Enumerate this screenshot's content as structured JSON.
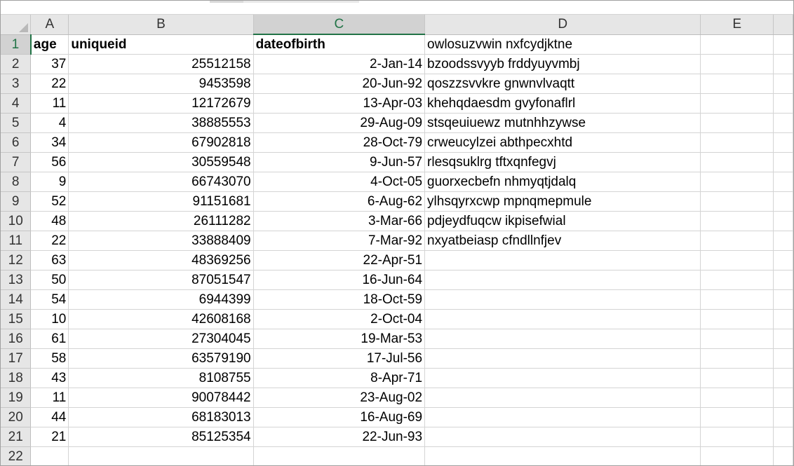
{
  "columns": [
    "A",
    "B",
    "C",
    "D",
    "E"
  ],
  "selected_column": "C",
  "selected_row": "1",
  "header_row": {
    "row": "1",
    "A": "age",
    "B": "uniqueid",
    "C": "dateofbirth",
    "D": "owlosuzvwin nxfcydjktne",
    "E": ""
  },
  "rows": [
    {
      "row": "2",
      "A": "37",
      "B": "25512158",
      "C": "2-Jan-14",
      "D": "bzoodssvyyb frddyuyvmbj",
      "E": ""
    },
    {
      "row": "3",
      "A": "22",
      "B": "9453598",
      "C": "20-Jun-92",
      "D": "qoszzsvvkre gnwnvlvaqtt",
      "E": ""
    },
    {
      "row": "4",
      "A": "11",
      "B": "12172679",
      "C": "13-Apr-03",
      "D": "khehqdaesdm gvyfonaflrl",
      "E": ""
    },
    {
      "row": "5",
      "A": "4",
      "B": "38885553",
      "C": "29-Aug-09",
      "D": "stsqeuiuewz mutnhhzywse",
      "E": ""
    },
    {
      "row": "6",
      "A": "34",
      "B": "67902818",
      "C": "28-Oct-79",
      "D": "crweucylzei abthpecxhtd",
      "E": ""
    },
    {
      "row": "7",
      "A": "56",
      "B": "30559548",
      "C": "9-Jun-57",
      "D": "rlesqsuklrg tftxqnfegvj",
      "E": ""
    },
    {
      "row": "8",
      "A": "9",
      "B": "66743070",
      "C": "4-Oct-05",
      "D": "guorxecbefn nhmyqtjdalq",
      "E": ""
    },
    {
      "row": "9",
      "A": "52",
      "B": "91151681",
      "C": "6-Aug-62",
      "D": "ylhsqyrxcwp mpnqmepmule",
      "E": ""
    },
    {
      "row": "10",
      "A": "48",
      "B": "26111282",
      "C": "3-Mar-66",
      "D": "pdjeydfuqcw ikpisefwial",
      "E": ""
    },
    {
      "row": "11",
      "A": "22",
      "B": "33888409",
      "C": "7-Mar-92",
      "D": "nxyatbeiasp cfndllnfjev",
      "E": ""
    },
    {
      "row": "12",
      "A": "63",
      "B": "48369256",
      "C": "22-Apr-51",
      "D": "",
      "E": ""
    },
    {
      "row": "13",
      "A": "50",
      "B": "87051547",
      "C": "16-Jun-64",
      "D": "",
      "E": ""
    },
    {
      "row": "14",
      "A": "54",
      "B": "6944399",
      "C": "18-Oct-59",
      "D": "",
      "E": ""
    },
    {
      "row": "15",
      "A": "10",
      "B": "42608168",
      "C": "2-Oct-04",
      "D": "",
      "E": ""
    },
    {
      "row": "16",
      "A": "61",
      "B": "27304045",
      "C": "19-Mar-53",
      "D": "",
      "E": ""
    },
    {
      "row": "17",
      "A": "58",
      "B": "63579190",
      "C": "17-Jul-56",
      "D": "",
      "E": ""
    },
    {
      "row": "18",
      "A": "43",
      "B": "8108755",
      "C": "8-Apr-71",
      "D": "",
      "E": ""
    },
    {
      "row": "19",
      "A": "11",
      "B": "90078442",
      "C": "23-Aug-02",
      "D": "",
      "E": ""
    },
    {
      "row": "20",
      "A": "44",
      "B": "68183013",
      "C": "16-Aug-69",
      "D": "",
      "E": ""
    },
    {
      "row": "21",
      "A": "21",
      "B": "85125354",
      "C": "22-Jun-93",
      "D": "",
      "E": ""
    },
    {
      "row": "22",
      "A": "",
      "B": "",
      "C": "",
      "D": "",
      "E": ""
    }
  ],
  "colors": {
    "selection_accent": "#217346",
    "header_bg": "#e6e6e6",
    "selected_header_bg": "#d2d2d2",
    "gridline": "#d4d4d4"
  }
}
